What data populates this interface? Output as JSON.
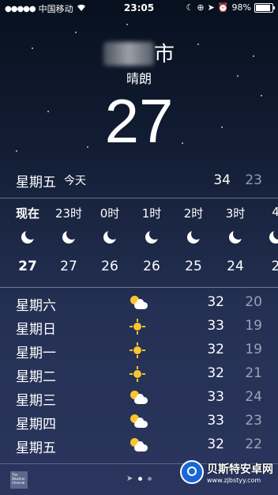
{
  "status": {
    "carrier": "中国移动",
    "time": "23:05",
    "battery": "98%",
    "battery_level": 0.98
  },
  "location": {
    "city_suffix": "市",
    "condition": "晴朗",
    "temperature": "27"
  },
  "today": {
    "day": "星期五",
    "tag": "今天",
    "high": "34",
    "low": "23"
  },
  "hourly": [
    {
      "label": "现在",
      "icon": "moon-icon",
      "temp": "27"
    },
    {
      "label": "23时",
      "icon": "moon-icon",
      "temp": "27"
    },
    {
      "label": "0时",
      "icon": "moon-icon",
      "temp": "26"
    },
    {
      "label": "1时",
      "icon": "moon-icon",
      "temp": "26"
    },
    {
      "label": "2时",
      "icon": "moon-icon",
      "temp": "25"
    },
    {
      "label": "3时",
      "icon": "moon-icon",
      "temp": "24"
    },
    {
      "label": "4",
      "icon": "moon-icon",
      "temp": "2"
    }
  ],
  "daily": [
    {
      "day": "星期六",
      "icon": "partly-cloudy-icon",
      "high": "32",
      "low": "20"
    },
    {
      "day": "星期日",
      "icon": "sun-icon",
      "high": "33",
      "low": "19"
    },
    {
      "day": "星期一",
      "icon": "sun-icon",
      "high": "32",
      "low": "19"
    },
    {
      "day": "星期二",
      "icon": "sun-icon",
      "high": "32",
      "low": "21"
    },
    {
      "day": "星期三",
      "icon": "partly-cloudy-icon",
      "high": "33",
      "low": "24"
    },
    {
      "day": "星期四",
      "icon": "partly-cloudy-icon",
      "high": "33",
      "low": "23"
    },
    {
      "day": "星期五",
      "icon": "partly-cloudy-icon",
      "high": "32",
      "low": "22"
    }
  ],
  "footer": {
    "twc_logo": "The Weather Channel"
  },
  "watermark": {
    "name": "贝斯特安卓网",
    "url": "www.zjbstyy.com"
  }
}
